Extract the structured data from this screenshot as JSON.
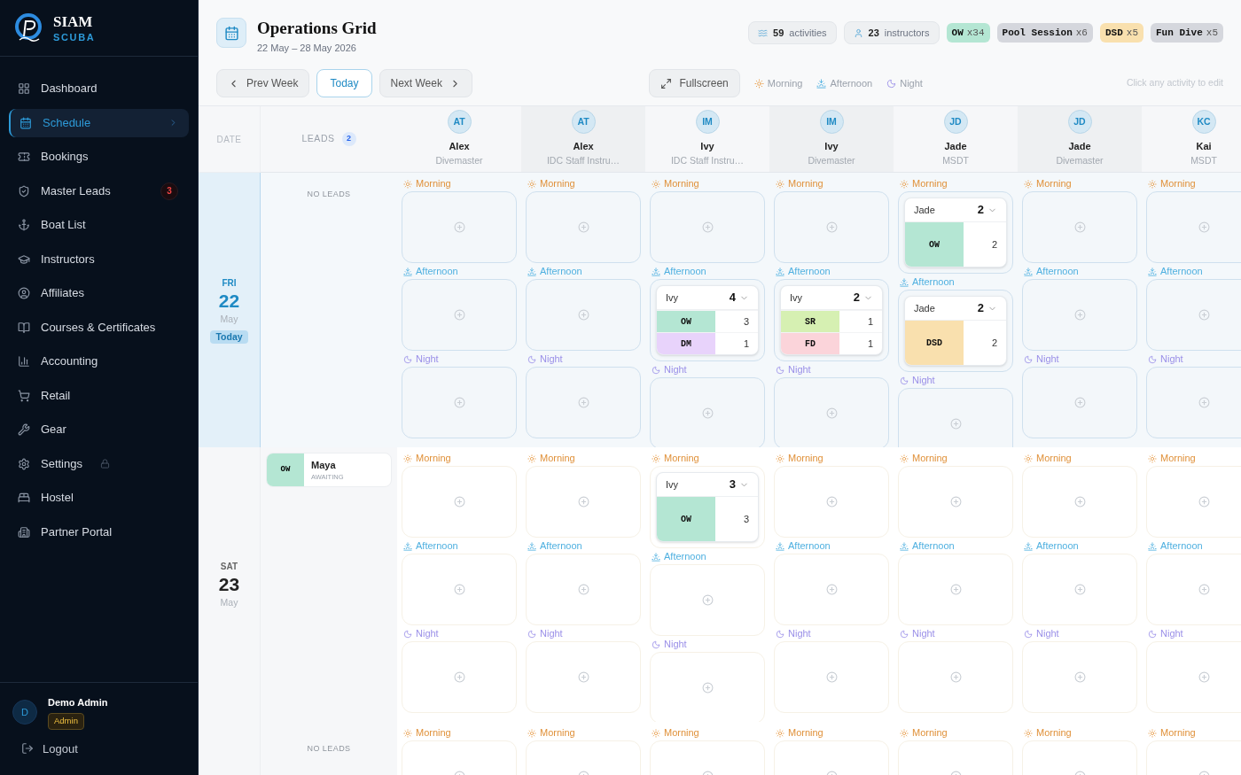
{
  "sidebar": {
    "brand": {
      "name": "SIAM",
      "sub": "SCUBA"
    },
    "items": [
      {
        "label": "Dashboard",
        "selected": false
      },
      {
        "label": "Schedule",
        "selected": true
      },
      {
        "label": "Bookings",
        "selected": false
      },
      {
        "label": "Master Leads",
        "selected": false,
        "badge": "3"
      },
      {
        "label": "Boat List",
        "selected": false
      },
      {
        "label": "Instructors",
        "selected": false
      },
      {
        "label": "Affiliates",
        "selected": false
      },
      {
        "label": "Courses & Certificates",
        "selected": false
      },
      {
        "label": "Accounting",
        "selected": false
      },
      {
        "label": "Retail",
        "selected": false
      },
      {
        "label": "Gear",
        "selected": false
      },
      {
        "label": "Settings",
        "selected": false,
        "locked": true
      },
      {
        "label": "Hostel",
        "selected": false
      },
      {
        "label": "Partner Portal",
        "selected": false
      }
    ],
    "user": {
      "initial": "D",
      "name": "Demo Admin",
      "role": "Admin"
    },
    "logout": "Logout"
  },
  "header": {
    "title": "Operations Grid",
    "dates": "22 May – 28 May 2026",
    "stats": [
      {
        "kind": "activities",
        "value": "59",
        "label": "activities"
      },
      {
        "kind": "instructors",
        "value": "23",
        "label": "instructors"
      }
    ],
    "tags": [
      {
        "code": "OW",
        "count": "x34",
        "color": "#b4e6d3"
      },
      {
        "code": "Pool Session",
        "count": "x6",
        "color": "#d5d7dd"
      },
      {
        "code": "DSD",
        "count": "x5",
        "color": "#f9e0ae"
      },
      {
        "code": "Fun Dive",
        "count": "x5",
        "color": "#d5d7dd"
      }
    ],
    "prev": "Prev Week",
    "today": "Today",
    "next": "Next Week",
    "fullscreen": "Fullscreen",
    "legend": [
      {
        "kind": "morning",
        "label": "Morning"
      },
      {
        "kind": "afternoon",
        "label": "Afternoon"
      },
      {
        "kind": "night",
        "label": "Night"
      }
    ],
    "hint": "Click any activity to edit"
  },
  "grid": {
    "date_heading": "DATE",
    "leads_heading": "LEADS",
    "leads_count": "2",
    "instructors": [
      {
        "initials": "AT",
        "name": "Alex",
        "role": "Divemaster"
      },
      {
        "initials": "AT",
        "name": "Alex",
        "role": "IDC Staff Instru…"
      },
      {
        "initials": "IM",
        "name": "Ivy",
        "role": "IDC Staff Instru…"
      },
      {
        "initials": "IM",
        "name": "Ivy",
        "role": "Divemaster"
      },
      {
        "initials": "JD",
        "name": "Jade",
        "role": "MSDT"
      },
      {
        "initials": "JD",
        "name": "Jade",
        "role": "Divemaster"
      },
      {
        "initials": "KC",
        "name": "Kai",
        "role": "MSDT"
      }
    ],
    "days": [
      {
        "weekday": "FRI",
        "day": "22",
        "month": "May",
        "badge": "Today",
        "selected": true,
        "no_leads": "NO LEADS",
        "columns": [
          {
            "slots": [
              {
                "kind": "morning",
                "label": "Morning"
              },
              {
                "kind": "afternoon",
                "label": "Afternoon"
              },
              {
                "kind": "night",
                "label": "Night"
              }
            ]
          },
          {
            "slots": [
              {
                "kind": "morning",
                "label": "Morning"
              },
              {
                "kind": "afternoon",
                "label": "Afternoon"
              },
              {
                "kind": "night",
                "label": "Night"
              }
            ]
          },
          {
            "slots": [
              {
                "kind": "morning",
                "label": "Morning"
              },
              {
                "kind": "afternoon",
                "label": "Afternoon",
                "booking": {
                  "instructor": "Ivy",
                  "total": "4",
                  "items": [
                    {
                      "code": "OW",
                      "count": "3",
                      "color": "#b4e6d3"
                    },
                    {
                      "code": "DM",
                      "count": "1",
                      "color": "#e8d3fb"
                    }
                  ]
                }
              },
              {
                "kind": "night",
                "label": "Night"
              }
            ]
          },
          {
            "slots": [
              {
                "kind": "morning",
                "label": "Morning"
              },
              {
                "kind": "afternoon",
                "label": "Afternoon",
                "booking": {
                  "instructor": "Ivy",
                  "total": "2",
                  "items": [
                    {
                      "code": "SR",
                      "count": "1",
                      "color": "#d6f0b2"
                    },
                    {
                      "code": "FD",
                      "count": "1",
                      "color": "#fbd4da"
                    }
                  ]
                }
              },
              {
                "kind": "night",
                "label": "Night"
              }
            ]
          },
          {
            "slots": [
              {
                "kind": "morning",
                "label": "Morning",
                "booking": {
                  "instructor": "Jade",
                  "total": "2",
                  "items": [
                    {
                      "code": "OW",
                      "count": "2",
                      "color": "#b4e6d3"
                    }
                  ]
                }
              },
              {
                "kind": "afternoon",
                "label": "Afternoon",
                "booking": {
                  "instructor": "Jade",
                  "total": "2",
                  "items": [
                    {
                      "code": "DSD",
                      "count": "2",
                      "color": "#f9e0ae"
                    }
                  ]
                }
              },
              {
                "kind": "night",
                "label": "Night"
              }
            ]
          },
          {
            "slots": [
              {
                "kind": "morning",
                "label": "Morning"
              },
              {
                "kind": "afternoon",
                "label": "Afternoon"
              },
              {
                "kind": "night",
                "label": "Night"
              }
            ]
          },
          {
            "slots": [
              {
                "kind": "morning",
                "label": "Morning"
              },
              {
                "kind": "afternoon",
                "label": "Afternoon"
              },
              {
                "kind": "night",
                "label": "Night"
              }
            ]
          }
        ]
      },
      {
        "weekday": "SAT",
        "day": "23",
        "month": "May",
        "selected": false,
        "leads": [
          {
            "code": "OW",
            "color": "#b4e6d3",
            "name": "Maya",
            "status": "AWAITING"
          }
        ],
        "columns": [
          {
            "slots": [
              {
                "kind": "morning",
                "label": "Morning"
              },
              {
                "kind": "afternoon",
                "label": "Afternoon"
              },
              {
                "kind": "night",
                "label": "Night"
              }
            ]
          },
          {
            "slots": [
              {
                "kind": "morning",
                "label": "Morning"
              },
              {
                "kind": "afternoon",
                "label": "Afternoon"
              },
              {
                "kind": "night",
                "label": "Night"
              }
            ]
          },
          {
            "slots": [
              {
                "kind": "morning",
                "label": "Morning",
                "booking": {
                  "instructor": "Ivy",
                  "total": "3",
                  "items": [
                    {
                      "code": "OW",
                      "count": "3",
                      "color": "#b4e6d3"
                    }
                  ]
                }
              },
              {
                "kind": "afternoon",
                "label": "Afternoon"
              },
              {
                "kind": "night",
                "label": "Night"
              }
            ]
          },
          {
            "slots": [
              {
                "kind": "morning",
                "label": "Morning"
              },
              {
                "kind": "afternoon",
                "label": "Afternoon"
              },
              {
                "kind": "night",
                "label": "Night"
              }
            ]
          },
          {
            "slots": [
              {
                "kind": "morning",
                "label": "Morning"
              },
              {
                "kind": "afternoon",
                "label": "Afternoon"
              },
              {
                "kind": "night",
                "label": "Night"
              }
            ]
          },
          {
            "slots": [
              {
                "kind": "morning",
                "label": "Morning"
              },
              {
                "kind": "afternoon",
                "label": "Afternoon"
              },
              {
                "kind": "night",
                "label": "Night"
              }
            ]
          },
          {
            "slots": [
              {
                "kind": "morning",
                "label": "Morning"
              },
              {
                "kind": "afternoon",
                "label": "Afternoon"
              },
              {
                "kind": "night",
                "label": "Night"
              }
            ]
          }
        ]
      },
      {
        "selected": false,
        "no_leads": "NO LEADS",
        "columns": [
          {
            "slots": [
              {
                "kind": "morning",
                "label": "Morning"
              }
            ]
          },
          {
            "slots": [
              {
                "kind": "morning",
                "label": "Morning"
              }
            ]
          },
          {
            "slots": [
              {
                "kind": "morning",
                "label": "Morning"
              }
            ]
          },
          {
            "slots": [
              {
                "kind": "morning",
                "label": "Morning"
              }
            ]
          },
          {
            "slots": [
              {
                "kind": "morning",
                "label": "Morning"
              }
            ]
          },
          {
            "slots": [
              {
                "kind": "morning",
                "label": "Morning"
              }
            ]
          },
          {
            "slots": [
              {
                "kind": "morning",
                "label": "Morning"
              }
            ]
          }
        ]
      }
    ]
  }
}
